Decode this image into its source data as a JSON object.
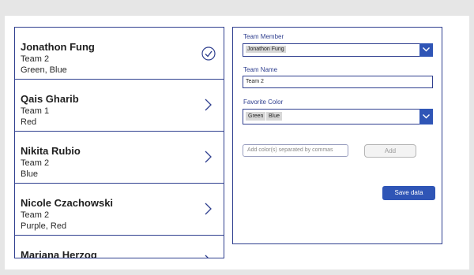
{
  "gallery": {
    "items": [
      {
        "name": "Jonathon Fung",
        "team": "Team 2",
        "colors": "Green, Blue",
        "selected": true
      },
      {
        "name": "Qais Gharib",
        "team": "Team 1",
        "colors": "Red",
        "selected": false
      },
      {
        "name": "Nikita Rubio",
        "team": "Team 2",
        "colors": "Blue",
        "selected": false
      },
      {
        "name": "Nicole Czachowski",
        "team": "Team 2",
        "colors": "Purple, Red",
        "selected": false
      },
      {
        "name": "Mariana Herzog",
        "team": "",
        "colors": "",
        "selected": false
      }
    ]
  },
  "form": {
    "team_member_label": "Team Member",
    "team_member_value": "Jonathon Fung",
    "team_name_label": "Team Name",
    "team_name_value": "Team 2",
    "favorite_color_label": "Favorite Color",
    "favorite_colors": [
      "Green",
      "Blue"
    ],
    "add_color_placeholder": "Add color(s) separated by commas",
    "add_button": "Add",
    "save_button": "Save data"
  },
  "colors": {
    "accent": "#2f55b6",
    "border": "#2f3f8f"
  }
}
